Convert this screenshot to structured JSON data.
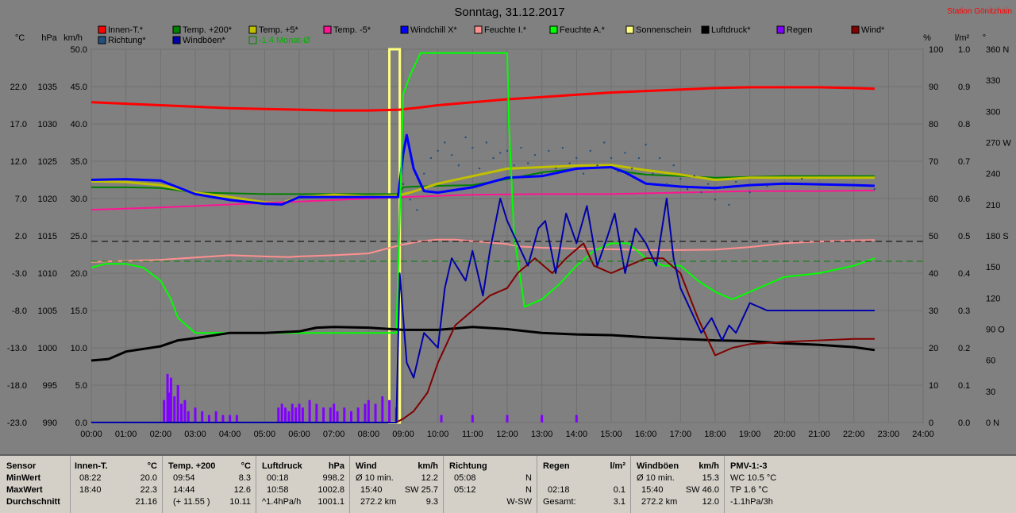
{
  "title": "Sonntag, 31.12.2017",
  "station": "Station Gönitzhain",
  "colors": {
    "background": "#808080",
    "plot": "#808080",
    "innen": "#ff0000",
    "temp200": "#008000",
    "temp5": "#c0c000",
    "tempminus5": "#ff1493",
    "windchill": "#0000ff",
    "feuchteI": "#ff9090",
    "feuchteA": "#00ff00",
    "sonnenschein": "#ffff80",
    "luftdruck": "#000000",
    "richtung": "#205080",
    "windboeen": "#0000aa",
    "monat": "#008000",
    "regen": "#8000ff",
    "wind": "#800000"
  },
  "legend": [
    {
      "label": "Innen-T.*",
      "color": "#ff0000"
    },
    {
      "label": "Temp. +200*",
      "color": "#008000"
    },
    {
      "label": "Temp. +5*",
      "color": "#c0c000"
    },
    {
      "label": "Temp. -5*",
      "color": "#ff1493"
    },
    {
      "label": "Windchill X*",
      "color": "#0000ff"
    },
    {
      "label": "Feuchte I.*",
      "color": "#ff9090"
    },
    {
      "label": "Feuchte A.*",
      "color": "#00ff00"
    },
    {
      "label": "Sonnenschein",
      "color": "#ffff80"
    },
    {
      "label": "Luftdruck*",
      "color": "#000000"
    },
    {
      "label": "Regen",
      "color": "#8000ff"
    },
    {
      "label": "Wind*",
      "color": "#800000"
    },
    {
      "label": "Richtung*",
      "color": "#205080"
    },
    {
      "label": "Windböen*",
      "color": "#0000aa"
    },
    {
      "label": "-1.4 Monat-Ø",
      "color": "#008000",
      "text_color": "#00b000",
      "hollow": true
    }
  ],
  "unit_labels": [
    "°C",
    "hPa",
    "km/h",
    "%",
    "l/m²",
    "°"
  ],
  "axes": {
    "temp_ticks": [
      "22.0",
      "17.0",
      "12.0",
      "7.0",
      "2.0",
      "-3.0",
      "-8.0",
      "-13.0",
      "-18.0",
      "-23.0"
    ],
    "hpa_ticks": [
      "1035",
      "1030",
      "1025",
      "1020",
      "1015",
      "1010",
      "1005",
      "1000",
      "995",
      "990"
    ],
    "kmh_ticks": [
      "50.0",
      "45.0",
      "40.0",
      "35.0",
      "30.0",
      "25.0",
      "20.0",
      "15.0",
      "10.0",
      "5.0",
      "0.0"
    ],
    "pct_ticks": [
      "100",
      "90",
      "80",
      "70",
      "60",
      "50",
      "40",
      "30",
      "20",
      "10",
      "0"
    ],
    "rain_ticks": [
      "1.0",
      "0.9",
      "0.8",
      "0.7",
      "0.6",
      "0.5",
      "0.4",
      "0.3",
      "0.2",
      "0.1",
      "0.0"
    ],
    "deg_ticks": [
      "360 N",
      "330",
      "300",
      "270 W",
      "240",
      "210",
      "180 S",
      "150",
      "120",
      "90 O",
      "60",
      "30",
      "0 N"
    ],
    "x_ticks": [
      "00:00",
      "01:00",
      "02:00",
      "03:00",
      "04:00",
      "05:00",
      "06:00",
      "07:00",
      "08:00",
      "09:00",
      "10:00",
      "11:00",
      "12:00",
      "13:00",
      "14:00",
      "15:00",
      "16:00",
      "17:00",
      "18:00",
      "19:00",
      "20:00",
      "21:00",
      "22:00",
      "23:00",
      "24:00"
    ],
    "x_range_hours": [
      0,
      24
    ],
    "temp_range": [
      -23,
      27
    ],
    "hpa_range": [
      990,
      1040
    ],
    "kmh_range": [
      0,
      50
    ],
    "pct_range": [
      0,
      100
    ],
    "rain_range": [
      0,
      1
    ],
    "deg_range": [
      0,
      360
    ],
    "grid": true
  },
  "chart_data": {
    "type": "line",
    "x_label": "",
    "series": [
      {
        "name": "Innen-T.*",
        "axis": "temp",
        "color": "#ff0000",
        "x": [
          0,
          1,
          2,
          3,
          4,
          5,
          6,
          7,
          8,
          8.9,
          9.5,
          10,
          11,
          12,
          13,
          14,
          15,
          16,
          17,
          18,
          19,
          20,
          21,
          22,
          22.6
        ],
        "y": [
          19.9,
          19.7,
          19.5,
          19.3,
          19.1,
          19.0,
          18.9,
          18.8,
          18.8,
          18.9,
          19.2,
          19.5,
          19.9,
          20.3,
          20.6,
          20.9,
          21.2,
          21.4,
          21.6,
          21.8,
          21.9,
          21.9,
          21.9,
          21.8,
          21.7
        ]
      },
      {
        "name": "Temp. +200*",
        "axis": "temp",
        "color": "#008000",
        "x": [
          0,
          1,
          2,
          3,
          4,
          5,
          6,
          7,
          8,
          8.85,
          9.0,
          9.3,
          10,
          11,
          12,
          13,
          14,
          15,
          15.5,
          16,
          17,
          18,
          19,
          20,
          21,
          22,
          22.6
        ],
        "y": [
          8.5,
          8.5,
          8.4,
          7.8,
          7.7,
          7.6,
          7.6,
          7.6,
          7.6,
          7.6,
          8.5,
          8.6,
          8.7,
          8.8,
          9.6,
          10.5,
          11.0,
          11.2,
          10.5,
          10.2,
          10.0,
          9.8,
          9.9,
          10.0,
          10.0,
          10.0,
          10.0
        ]
      },
      {
        "name": "Temp. +5*",
        "axis": "temp",
        "color": "#c0c000",
        "x": [
          0,
          1,
          2,
          3,
          4,
          5,
          5.5,
          6,
          7,
          8,
          8.85,
          9.2,
          10,
          11,
          12,
          13,
          14,
          15,
          16,
          17,
          18,
          19,
          20,
          21,
          22,
          22.6
        ],
        "y": [
          9.3,
          9.2,
          8.8,
          7.8,
          7.2,
          6.5,
          6.4,
          7.2,
          7.5,
          7.3,
          7.4,
          7.8,
          9.0,
          10.0,
          11.0,
          11.2,
          11.4,
          11.5,
          10.8,
          10.2,
          9.5,
          9.8,
          9.8,
          9.8,
          9.8,
          9.8
        ]
      },
      {
        "name": "Temp. -5*",
        "axis": "temp",
        "color": "#ff1493",
        "x": [
          0,
          2,
          4,
          6,
          8,
          9,
          11,
          13,
          15,
          17,
          19,
          21,
          22.6
        ],
        "y": [
          5.5,
          5.8,
          6.2,
          6.6,
          7.0,
          7.2,
          7.5,
          7.6,
          7.6,
          7.8,
          8.0,
          8.0,
          8.1
        ]
      },
      {
        "name": "Windchill X*",
        "axis": "temp",
        "color": "#0000ff",
        "x": [
          0,
          1,
          2,
          3,
          4,
          5,
          5.5,
          6,
          7,
          8,
          8.85,
          9.0,
          9.1,
          9.3,
          9.6,
          10,
          11,
          12,
          13,
          14,
          15,
          15.4,
          16,
          17,
          18,
          19,
          20,
          21,
          22,
          22.6
        ],
        "y": [
          9.5,
          9.6,
          9.4,
          7.6,
          6.8,
          6.3,
          6.2,
          7.2,
          7.2,
          7.2,
          7.2,
          13.0,
          15.5,
          11.0,
          8.0,
          7.8,
          8.5,
          9.8,
          10.0,
          11.0,
          11.2,
          10.5,
          9.0,
          8.6,
          8.4,
          8.8,
          9.0,
          8.9,
          8.8,
          8.7
        ]
      },
      {
        "name": "Feuchte I.*",
        "axis": "pct",
        "color": "#ff9090",
        "x": [
          0,
          1,
          2,
          3,
          4,
          5,
          5.7,
          6,
          7,
          8,
          8.9,
          9.5,
          10,
          10.5,
          11,
          12,
          12.3,
          13,
          14,
          15,
          16,
          17,
          18,
          19,
          20,
          21,
          22,
          22.6
        ],
        "y": [
          43,
          43.3,
          43.6,
          44.2,
          44.8,
          44.5,
          44.3,
          44.5,
          44.8,
          45.3,
          47.5,
          48.6,
          49.0,
          49.0,
          48.6,
          47.8,
          47.2,
          46.8,
          46.6,
          46.4,
          46.2,
          46.2,
          46.3,
          47.0,
          48.0,
          48.5,
          48.8,
          48.9
        ]
      },
      {
        "name": "Feuchte A.*",
        "axis": "pct",
        "color": "#00ff00",
        "x": [
          0,
          0.4,
          1,
          1.5,
          2,
          2.3,
          2.5,
          3,
          4,
          5,
          6,
          7,
          8,
          8.8,
          8.9,
          9.0,
          9.2,
          9.5,
          10,
          11,
          12,
          12.05,
          12.2,
          12.5,
          13,
          13.5,
          14,
          14.5,
          15,
          15.5,
          16,
          16.5,
          17,
          17.5,
          18,
          18.5,
          19,
          20,
          21,
          22,
          22.6
        ],
        "y": [
          41.5,
          42.5,
          42.5,
          41.5,
          38,
          33,
          28,
          24,
          24,
          24,
          24,
          24,
          24,
          24,
          55,
          88,
          93,
          99,
          99,
          99,
          99,
          80,
          50,
          31,
          33,
          37,
          42,
          46,
          48,
          48,
          44,
          42,
          42,
          38,
          35,
          33,
          35,
          39,
          40,
          42,
          44
        ]
      },
      {
        "name": "Sonnenschein",
        "axis": "pct",
        "color": "#ffff80",
        "type": "bar",
        "x": [
          8.6,
          8.9
        ],
        "y": [
          100,
          100
        ]
      },
      {
        "name": "Luftdruck*",
        "axis": "hpa",
        "color": "#000000",
        "x": [
          0,
          0.5,
          1,
          2,
          2.5,
          3,
          4,
          5,
          6,
          6.5,
          7,
          8,
          9,
          10,
          11,
          12,
          13,
          14,
          15,
          16,
          17,
          18,
          19,
          20,
          21,
          22,
          22.6
        ],
        "y": [
          998.3,
          998.5,
          999.5,
          1000.2,
          1001.0,
          1001.3,
          1002.0,
          1002.0,
          1002.2,
          1002.7,
          1002.8,
          1002.7,
          1002.4,
          1002.4,
          1002.8,
          1002.5,
          1002.0,
          1001.8,
          1001.7,
          1001.4,
          1001.2,
          1001.0,
          1000.9,
          1000.6,
          1000.4,
          1000.1,
          999.7
        ]
      },
      {
        "name": "Regen",
        "axis": "rain",
        "color": "#8000ff",
        "type": "bar",
        "x": [
          2.1,
          2.2,
          2.25,
          2.3,
          2.4,
          2.5,
          2.6,
          2.7,
          2.8,
          3.0,
          3.2,
          3.4,
          3.6,
          3.8,
          4.0,
          4.2,
          5.4,
          5.5,
          5.6,
          5.7,
          5.8,
          5.9,
          6.0,
          6.1,
          6.3,
          6.5,
          6.7,
          6.9,
          7.0,
          7.1,
          7.3,
          7.5,
          7.7,
          7.9,
          8.0,
          8.2,
          8.4,
          8.6,
          8.8,
          10.1,
          11.0,
          12.0,
          13.0,
          14.0
        ],
        "y": [
          0.06,
          0.13,
          0.08,
          0.12,
          0.07,
          0.1,
          0.05,
          0.06,
          0.03,
          0.04,
          0.03,
          0.02,
          0.03,
          0.02,
          0.02,
          0.02,
          0.04,
          0.05,
          0.04,
          0.03,
          0.05,
          0.04,
          0.05,
          0.04,
          0.06,
          0.05,
          0.04,
          0.04,
          0.05,
          0.03,
          0.04,
          0.03,
          0.04,
          0.05,
          0.06,
          0.05,
          0.07,
          0.06,
          0.04,
          0.02,
          0.02,
          0.02,
          0.02,
          0.02
        ]
      },
      {
        "name": "Wind*",
        "axis": "kmh",
        "color": "#800000",
        "x": [
          0,
          8.8,
          9.0,
          9.3,
          9.7,
          10,
          10.5,
          11,
          11.5,
          12,
          12.3,
          12.8,
          13.3,
          13.7,
          14.2,
          14.5,
          15,
          15.5,
          16,
          16.5,
          17,
          17.5,
          18,
          18.5,
          19,
          20,
          21,
          22,
          22.6
        ],
        "y": [
          0,
          0,
          0.5,
          1.5,
          4,
          8,
          13,
          15,
          17,
          18,
          20,
          22,
          20,
          22,
          24,
          21,
          20,
          21,
          22,
          22,
          20,
          14,
          9,
          10,
          10.5,
          10.8,
          11,
          11.2,
          11.2
        ]
      },
      {
        "name": "Windböen*",
        "axis": "kmh",
        "color": "#0000aa",
        "x": [
          0,
          8.8,
          8.9,
          9.1,
          9.3,
          9.6,
          10,
          10.2,
          10.4,
          10.8,
          11,
          11.3,
          11.5,
          11.8,
          12,
          12.3,
          12.6,
          12.9,
          13.1,
          13.4,
          13.7,
          14,
          14.3,
          14.6,
          14.9,
          15.1,
          15.4,
          15.7,
          16,
          16.3,
          16.6,
          16.8,
          17,
          17.3,
          17.6,
          17.9,
          18.2,
          18.4,
          18.6,
          18.8,
          19,
          19.5,
          20,
          21,
          22,
          22.6
        ],
        "y": [
          0,
          0,
          20,
          8,
          6,
          12,
          10,
          18,
          22,
          19,
          23,
          17,
          23,
          30,
          27,
          24,
          21,
          26,
          27,
          20,
          28,
          24,
          29,
          21,
          25,
          28,
          20,
          26,
          24,
          21,
          30,
          22,
          18,
          15,
          12,
          14,
          11,
          13,
          12,
          14,
          16,
          15,
          15,
          15,
          15,
          15
        ]
      },
      {
        "name": "Richtung*",
        "axis": "deg",
        "color": "#205080",
        "type": "scatter",
        "x": [
          9.0,
          9.2,
          9.4,
          9.6,
          9.8,
          10.0,
          10.2,
          10.4,
          10.6,
          10.8,
          11.0,
          11.2,
          11.4,
          11.6,
          11.8,
          12.0,
          12.2,
          12.4,
          12.6,
          12.8,
          13.0,
          13.2,
          13.4,
          13.6,
          13.8,
          14.0,
          14.2,
          14.4,
          14.6,
          14.8,
          15.0,
          15.2,
          15.4,
          15.6,
          15.8,
          16.0,
          16.2,
          16.4,
          16.6,
          16.8,
          17.0,
          17.2,
          17.4,
          17.6,
          17.8,
          18.0,
          18.2,
          18.4,
          18.6,
          19.0,
          19.5,
          20.5,
          22.6
        ],
        "y": [
          230,
          215,
          205,
          240,
          255,
          262,
          270,
          258,
          248,
          275,
          265,
          245,
          270,
          255,
          260,
          262,
          248,
          265,
          250,
          258,
          240,
          262,
          245,
          265,
          250,
          255,
          240,
          262,
          248,
          270,
          255,
          242,
          260,
          245,
          255,
          268,
          240,
          255,
          230,
          248,
          235,
          225,
          238,
          222,
          230,
          215,
          226,
          210,
          232,
          222,
          228,
          235,
          225
        ]
      }
    ],
    "reference_lines": [
      {
        "axis": "pct",
        "y": 48.5,
        "style": "dashed",
        "color": "#000000"
      },
      {
        "axis": "temp",
        "y": -1.4,
        "style": "dashed",
        "color": "#008000"
      }
    ]
  },
  "stats": {
    "sensor": {
      "title": "Sensor",
      "rows": [
        "MinWert",
        "MaxWert",
        "Durchschnitt"
      ]
    },
    "innen": {
      "title": "Innen-T.",
      "unit": "°C",
      "rows": [
        [
          "08:22",
          "20.0"
        ],
        [
          "18:40",
          "22.3"
        ],
        [
          "",
          "21.16"
        ]
      ]
    },
    "temp200": {
      "title": "Temp. +200",
      "unit": "°C",
      "rows": [
        [
          "09:54",
          "8.3"
        ],
        [
          "14:44",
          "12.6"
        ],
        [
          "(+ 11.55 )",
          "10.11"
        ]
      ]
    },
    "luftdruck": {
      "title": "Luftdruck",
      "unit": "hPa",
      "rows": [
        [
          "00:18",
          "998.2"
        ],
        [
          "10:58",
          "1002.8"
        ],
        [
          "^1.4hPa/h",
          "1001.1"
        ]
      ]
    },
    "wind": {
      "title": "Wind",
      "unit": "km/h",
      "rows": [
        [
          "Ø 10 min.",
          "12.2"
        ],
        [
          "15:40",
          "SW 25.7"
        ],
        [
          "272.2 km",
          "9.3"
        ]
      ]
    },
    "richtung": {
      "title": "Richtung",
      "unit": "",
      "rows": [
        [
          "05:08",
          "N"
        ],
        [
          "05:12",
          "N"
        ],
        [
          "",
          "W-SW"
        ]
      ]
    },
    "regen": {
      "title": "Regen",
      "unit": "l/m²",
      "rows": [
        [
          "",
          ""
        ],
        [
          "02:18",
          "0.1"
        ],
        [
          "Gesamt:",
          "3.1"
        ]
      ]
    },
    "windboeen": {
      "title": "Windböen",
      "unit": "km/h",
      "rows": [
        [
          "Ø 10 min.",
          "15.3"
        ],
        [
          "15:40",
          "SW 46.0"
        ],
        [
          "272.2 km",
          "12.0"
        ]
      ]
    },
    "pmv": {
      "title": "PMV-1:-3",
      "rows": [
        "WC 10.5 °C",
        "TP 1.6 °C",
        "-1.1hPa/3h"
      ]
    }
  }
}
